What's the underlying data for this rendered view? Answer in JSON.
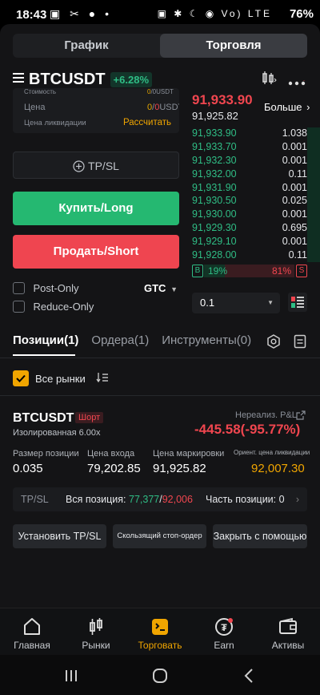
{
  "status": {
    "time": "18:43",
    "left_icons": "▣ ✂ ● •",
    "right_icons": "▣ ✱ ☾ ◉ Vo) LTE",
    "battery": "76%"
  },
  "top_tabs": [
    "График",
    "Торговля"
  ],
  "pair": {
    "symbol": "BTCUSDT",
    "change": "+6.28%"
  },
  "form": {
    "cost_label": "Стоимость",
    "cost_value_zero": "0",
    "cost_value_rest": "/0USDT",
    "price_label": "Цена",
    "price_value_zero": "0",
    "price_value_slash": "/",
    "price_value_red": "0",
    "price_value_rest": "USDT",
    "liq_label": "Цена ликвидации",
    "liq_action": "Рассчитать",
    "tpsl": "TP/SL",
    "buy": "Купить/Long",
    "sell": "Продать/Short",
    "post_only": "Post-Only",
    "reduce_only": "Reduce-Only",
    "tif": "GTC"
  },
  "book": {
    "last_price": "91,933.90",
    "mark_price": "91,925.82",
    "more": "Больше",
    "rows": [
      {
        "p": "91,933.90",
        "q": "1.038"
      },
      {
        "p": "91,933.70",
        "q": "0.001"
      },
      {
        "p": "91,932.30",
        "q": "0.001"
      },
      {
        "p": "91,932.00",
        "q": "0.11"
      },
      {
        "p": "91,931.90",
        "q": "0.001"
      },
      {
        "p": "91,930.50",
        "q": "0.025"
      },
      {
        "p": "91,930.00",
        "q": "0.001"
      },
      {
        "p": "91,929.30",
        "q": "0.695"
      },
      {
        "p": "91,929.10",
        "q": "0.001"
      },
      {
        "p": "91,928.00",
        "q": "0.11"
      }
    ],
    "buy_tag": "B",
    "buy_pct": "19%",
    "sell_pct": "81%",
    "sell_tag": "S",
    "step": "0.1"
  },
  "tabs": {
    "positions": "Позиции(1)",
    "orders": "Ордера(1)",
    "tools": "Инструменты(0)"
  },
  "filter": {
    "all_markets": "Все рынки"
  },
  "position": {
    "symbol": "BTCUSDT",
    "side": "Шорт",
    "margin": "Изолированная 6.00x",
    "pnl_label": "Нереализ. P&L",
    "pnl_value": "-445.58(-95.77%)",
    "size_label": "Размер позиции",
    "size": "0.035",
    "entry_label": "Цена входа",
    "entry": "79,202.85",
    "mark_label": "Цена маркировки",
    "mark": "91,925.82",
    "liq_label": "Ориент. цена ликвидации",
    "liq": "92,007.30",
    "tpsl_label": "TP/SL",
    "whole_label": "Вся позиция:",
    "tp_val": "77,377",
    "slash": "/",
    "sl_val": "92,006",
    "part_label": "Часть позиции: 0",
    "btn_set_tpsl": "Установить TP/SL",
    "btn_trailing": "Скользящий стоп-ордер",
    "btn_close_with": "Закрыть с помощью"
  },
  "nav": [
    {
      "label": "Главная",
      "icon": "home-icon"
    },
    {
      "label": "Рынки",
      "icon": "candles-icon"
    },
    {
      "label": "Торговать",
      "icon": "trade-icon"
    },
    {
      "label": "Earn",
      "icon": "earn-icon"
    },
    {
      "label": "Активы",
      "icon": "wallet-icon"
    }
  ],
  "colors": {
    "green": "#2fbd85",
    "red": "#f0464f",
    "orange": "#f0a500",
    "accent_nav": "#f0a500"
  }
}
